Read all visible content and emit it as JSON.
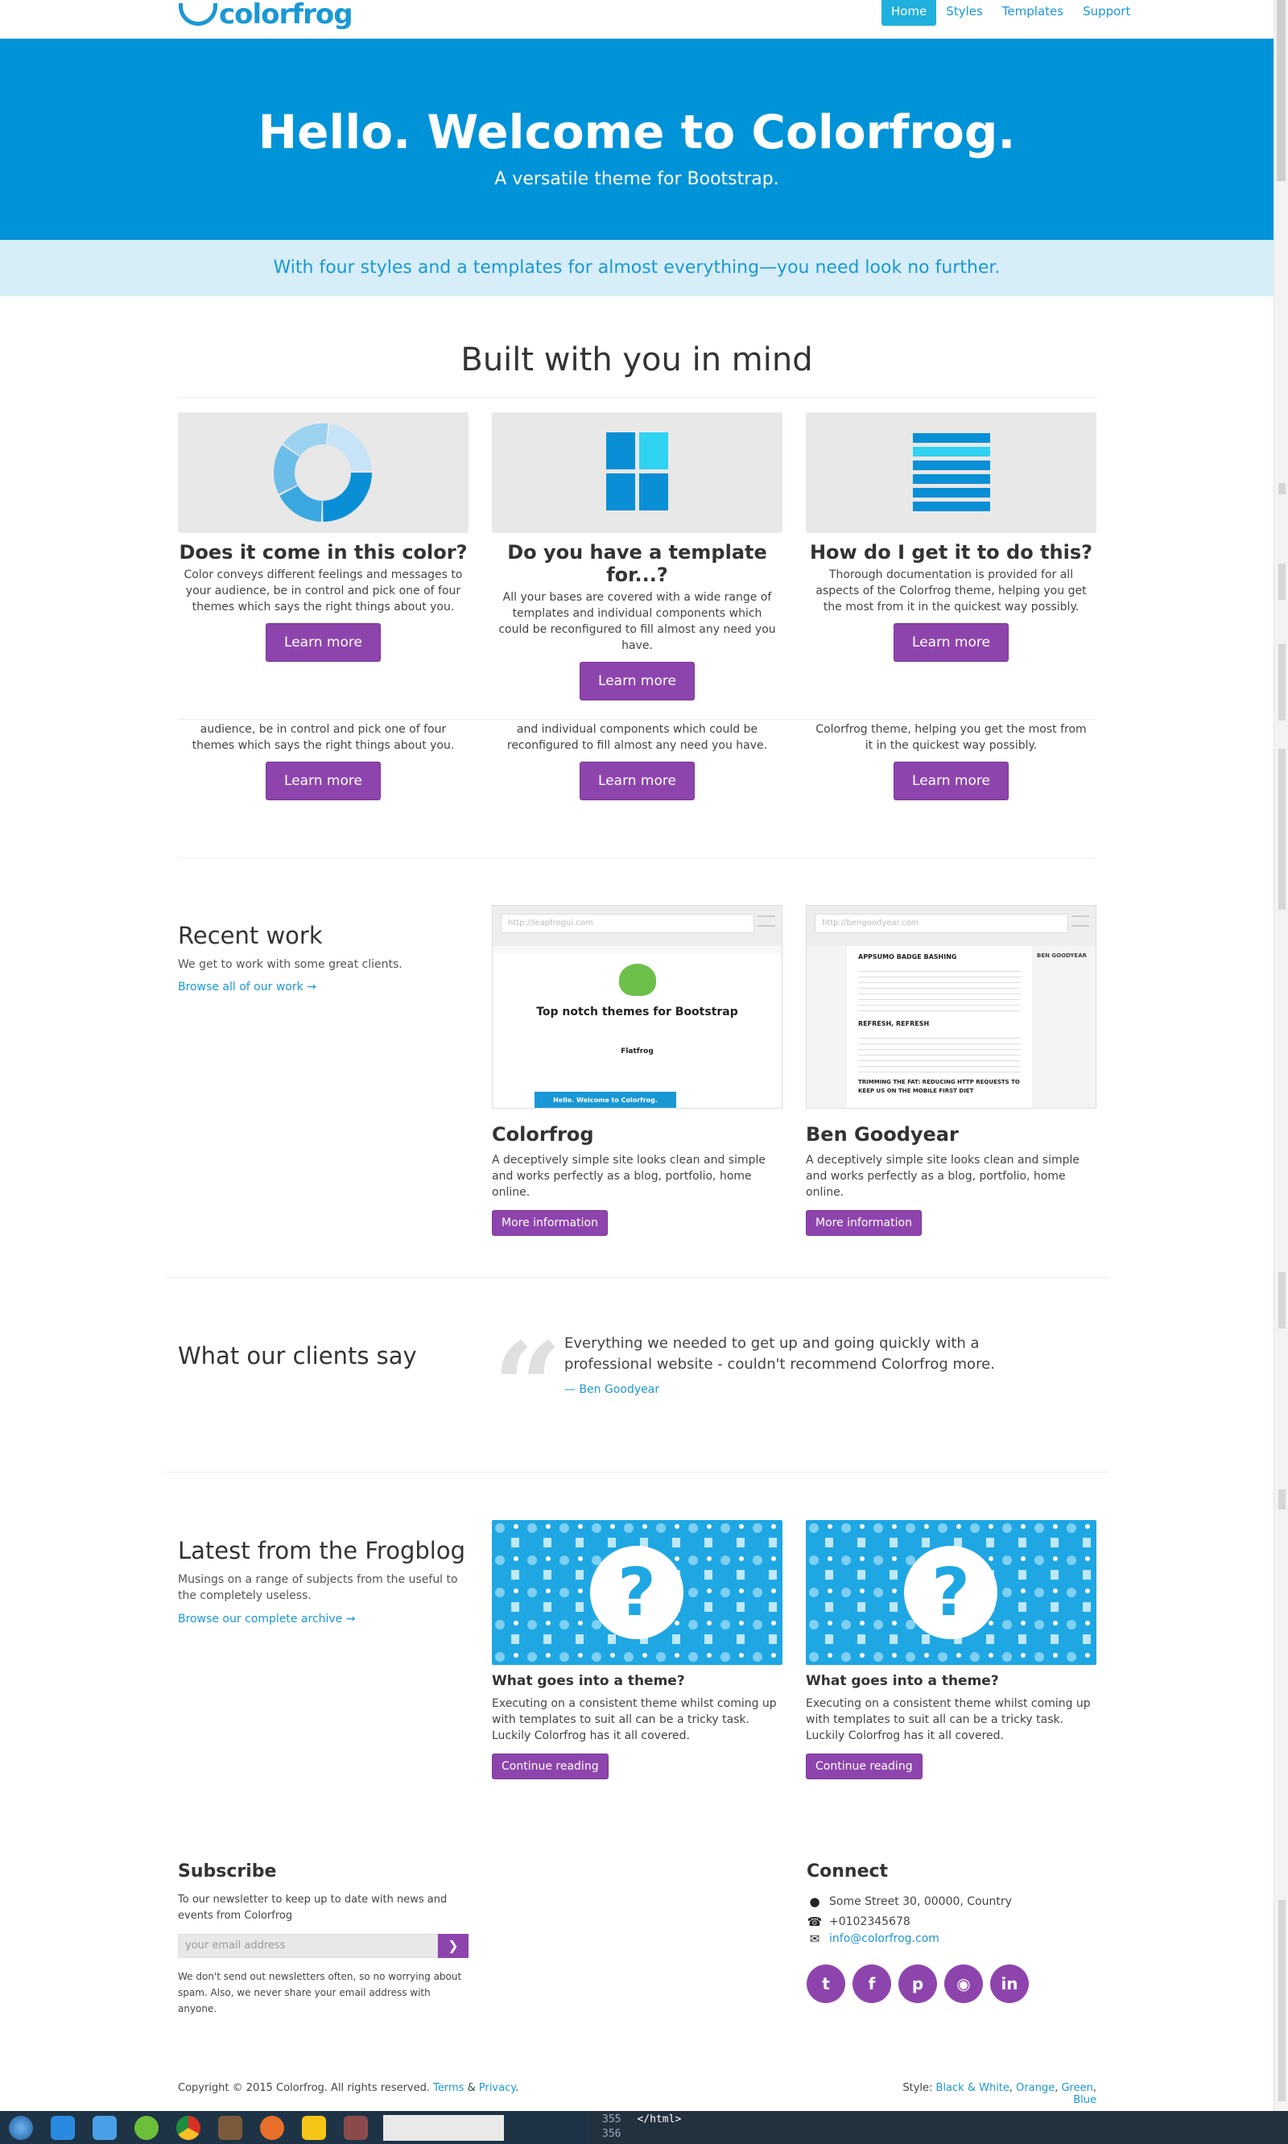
{
  "nav": {
    "logo_text": "colorfrog",
    "links": [
      "Home",
      "Styles",
      "Templates",
      "Support"
    ],
    "active": "Home"
  },
  "hero": {
    "title": "Hello. Welcome to Colorfrog.",
    "subtitle": "A versatile theme for Bootstrap."
  },
  "band": {
    "text": "With four styles and a templates for almost everything—you need look no further."
  },
  "built": {
    "title": "Built with you in mind",
    "features": [
      {
        "icon": "donut-chart-icon",
        "title": "Does it come in this color?",
        "text": "Color conveys different feelings and messages to your audience, be in control and pick one of four themes which says the right things about you.",
        "button": "Learn more"
      },
      {
        "icon": "template-grid-icon",
        "title": "Do you have a template for...?",
        "text": "All your bases are covered with a wide range of templates and individual components which could be reconfigured to fill almost any need you have.",
        "button": "Learn more"
      },
      {
        "icon": "list-lines-icon",
        "title": "How do I get it to do this?",
        "text": "Thorough documentation is provided for all aspects of the Colorfrog theme, helping you get the most from it in the quickest way possibly.",
        "button": "Learn more"
      }
    ],
    "duplicates": [
      {
        "text": "audience, be in control and pick one of four themes which says the right things about you.",
        "button": "Learn more"
      },
      {
        "text": "and individual components which could be reconfigured to fill almost any need you have.",
        "button": "Learn more"
      },
      {
        "text": "Colorfrog theme, helping you get the most from it in the quickest way possibly.",
        "button": "Learn more"
      }
    ]
  },
  "recent": {
    "title": "Recent work",
    "sub": "We get to work with some great clients.",
    "link": "Browse all of our work →",
    "items": [
      {
        "shot_url": "http://leapfrogui.com",
        "shot_heading": "Top notch themes for Bootstrap",
        "shot_sub": "Flatfrog",
        "shot_banner": "Hello. Welcome to Colorfrog.",
        "title": "Colorfrog",
        "text": "A deceptively simple site looks clean and simple and works perfectly as a blog, portfolio, home online.",
        "button": "More information"
      },
      {
        "shot_url": "http://bengoodyear.com",
        "shot_heading": "APPSUMO BADGE BASHING",
        "shot_sub": "REFRESH, REFRESH",
        "shot_banner": "TRIMMING THE FAT: REDUCING HTTP REQUESTS TO KEEP US ON THE MOBILE FIRST DIET",
        "shot_side": "BEN GOODYEAR",
        "title": "Ben Goodyear",
        "text": "A deceptively simple site looks clean and simple and works perfectly as a blog, portfolio, home online.",
        "button": "More information"
      }
    ]
  },
  "clients": {
    "title": "What our clients say",
    "quote": "Everything we needed to get up and going quickly with a professional website - couldn't recommend Colorfrog more.",
    "by": "— Ben Goodyear"
  },
  "blog": {
    "title": "Latest from the Frogblog",
    "sub": "Musings on a range of subjects from the useful to the completely useless.",
    "link": "Browse our complete archive →",
    "posts": [
      {
        "title": "What goes into a theme?",
        "text": "Executing on a consistent theme whilst coming up with templates to suit all can be a tricky task. Luckily Colorfrog has it all covered.",
        "button": "Continue reading"
      },
      {
        "title": "What goes into a theme?",
        "text": "Executing on a consistent theme whilst coming up with templates to suit all can be a tricky task. Luckily Colorfrog has it all covered.",
        "button": "Continue reading"
      }
    ]
  },
  "subscribe": {
    "title": "Subscribe",
    "text": "To our newsletter to keep up to date with news and events from Colorfrog",
    "placeholder": "your email address",
    "note": "We don't send out newsletters often, so no worrying about spam. Also, we never share your email address with anyone."
  },
  "connect": {
    "title": "Connect",
    "address": "Some Street 30, 00000, Country",
    "phone": "+0102345678",
    "email": "info@colorfrog.com",
    "social": [
      "twitter-icon",
      "facebook-icon",
      "pinterest-icon",
      "github-icon",
      "linkedin-icon"
    ]
  },
  "footer": {
    "copyright": "Copyright © 2015 Colorfrog. All rights reserved.",
    "terms": "Terms",
    "and": "&",
    "privacy": "Privacy",
    "style_label": "Style:",
    "styles": [
      "Black & White",
      "Orange",
      "Green",
      "Blue"
    ]
  },
  "editor": {
    "line1": "355",
    "line1_code": "</html>",
    "line2": "356"
  },
  "colors": {
    "primary": "#0093d8",
    "accent": "#8e44ad",
    "band": "#d7eef9"
  }
}
